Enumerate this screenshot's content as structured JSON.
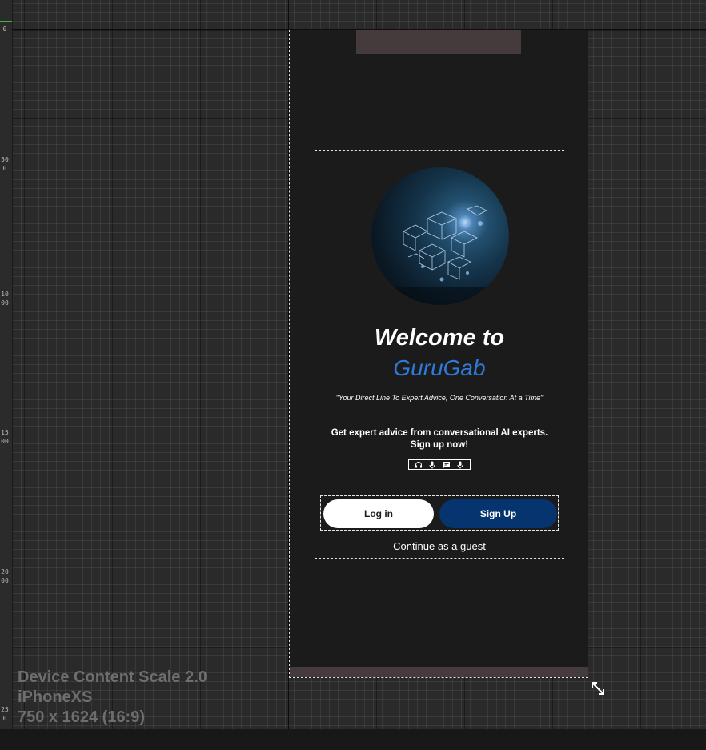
{
  "editor": {
    "ruler_labels": [
      "0",
      "500",
      "1000",
      "1500",
      "2000",
      "250"
    ],
    "device_info": {
      "scale_label": "Device Content Scale 2.0",
      "device_name": "iPhoneXS",
      "resolution_label": "750 x 1624 (16:9)"
    }
  },
  "app": {
    "logo_icon": "abstract-cubes-network-image",
    "welcome_text": "Welcome to",
    "app_name": "GuruGab",
    "tagline": "\"Your Direct Line To Expert Advice, One Conversation At a Time\"",
    "description": "Get expert advice from conversational AI experts. Sign up now!",
    "feature_icons": [
      "headphones-icon",
      "microphone-icon",
      "chat-icon",
      "microphone-icon"
    ],
    "login_label": "Log in",
    "signup_label": "Sign Up",
    "guest_label": "Continue as a guest"
  },
  "colors": {
    "app_background": "#1b1b1b",
    "brand_blue": "#2f7ad9",
    "signup_button": "#05346e",
    "login_button": "#ffffff",
    "notch_bar": "#463b3c"
  }
}
